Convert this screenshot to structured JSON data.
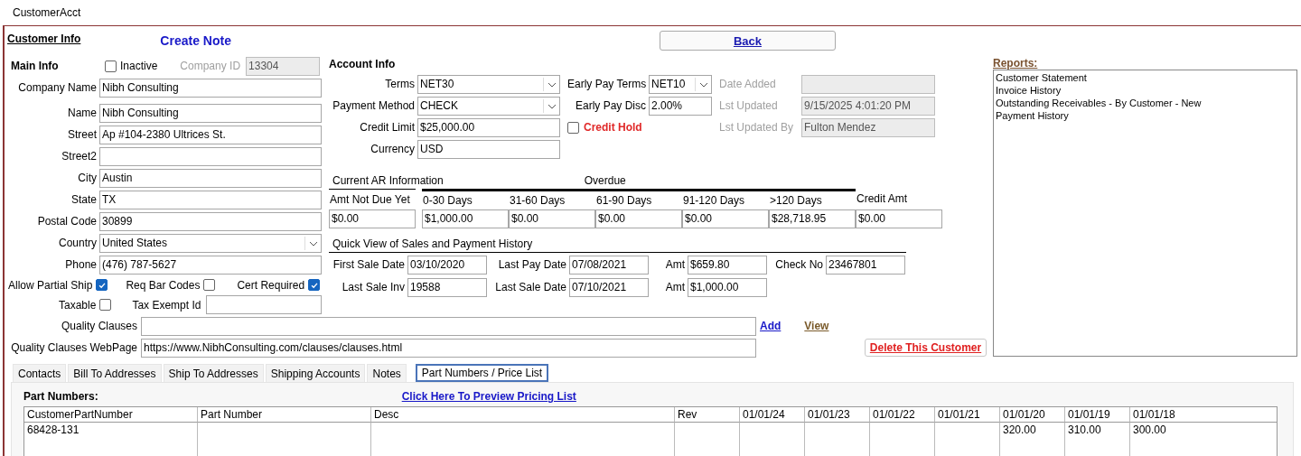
{
  "window": {
    "title": "CustomerAcct"
  },
  "header": {
    "section_link": "Customer Info",
    "create_note": "Create Note",
    "back_button": "Back"
  },
  "main_info": {
    "title": "Main Info",
    "inactive": {
      "label": "Inactive",
      "checked": false
    },
    "company_id": {
      "label": "Company ID",
      "value": "13304",
      "disabled": true
    },
    "fields": [
      {
        "label": "Company Name",
        "value": "Nibh Consulting",
        "kind": "text"
      },
      {
        "label": "Name",
        "value": "Nibh Consulting",
        "kind": "text"
      },
      {
        "label": "Street",
        "value": "Ap #104-2380 Ultrices St.",
        "kind": "text"
      },
      {
        "label": "Street2",
        "kind": "text"
      },
      {
        "label": "City",
        "value": "Austin",
        "kind": "text"
      },
      {
        "label": "State",
        "value": "TX",
        "kind": "text"
      },
      {
        "label": "Postal Code",
        "value": "30899",
        "kind": "text"
      },
      {
        "label": "Country",
        "value": "United States",
        "kind": "select"
      },
      {
        "label": "Phone",
        "value": "(476) 787-5627",
        "kind": "text"
      }
    ],
    "flags": [
      {
        "label": "Allow Partial Ship",
        "checked": true
      },
      {
        "label": "Req Bar Codes",
        "checked": false
      },
      {
        "label": "Cert Required",
        "checked": true
      }
    ],
    "taxable": {
      "label": "Taxable",
      "checked": false
    },
    "tax_exempt_id": {
      "label": "Tax Exempt Id"
    }
  },
  "account_info": {
    "title": "Account Info",
    "columns": [
      [
        {
          "label": "Terms",
          "value": "NET30",
          "kind": "select"
        },
        {
          "label": "Payment Method",
          "value": "CHECK",
          "kind": "select"
        },
        {
          "label": "Credit Limit",
          "value": "$25,000.00",
          "kind": "text"
        },
        {
          "label": "Currency",
          "value": "USD",
          "kind": "text"
        }
      ],
      [
        {
          "label": "Early Pay Terms",
          "value": "NET10",
          "kind": "select"
        },
        {
          "label": "Early Pay Disc",
          "value": "2.00%",
          "kind": "text"
        },
        {
          "label": "Credit Hold",
          "kind": "checkbox",
          "checked": false
        }
      ],
      [
        {
          "label": "Date Added",
          "kind": "text",
          "disabled": true
        },
        {
          "label": "Lst Updated",
          "value": "9/15/2025 4:01:20 PM",
          "kind": "text",
          "disabled": true
        },
        {
          "label": "Lst Updated By",
          "value": "Fulton Mendez",
          "kind": "text",
          "disabled": true
        }
      ]
    ]
  },
  "ar_info": {
    "title": "Current AR Information",
    "overdue_label": "Overdue",
    "buckets": [
      {
        "label": "Amt Not Due Yet",
        "value": "$0.00",
        "kind": "current"
      },
      {
        "label": "0-30 Days",
        "value": "$1,000.00",
        "kind": "overdue"
      },
      {
        "label": "31-60 Days",
        "value": "$0.00",
        "kind": "overdue"
      },
      {
        "label": "61-90 Days",
        "value": "$0.00",
        "kind": "overdue"
      },
      {
        "label": "91-120 Days",
        "value": "$0.00",
        "kind": "overdue"
      },
      {
        "label": ">120 Days",
        "value": "$28,718.95",
        "kind": "overdue"
      },
      {
        "label": "Credit Amt",
        "value": "$0.00",
        "kind": "credit"
      }
    ]
  },
  "quick_view": {
    "title": "Quick View of Sales and Payment History",
    "rows": [
      [
        {
          "label": "First Sale Date",
          "value": "03/10/2020"
        },
        {
          "label": "Last Pay Date",
          "value": "07/08/2021"
        },
        {
          "label": "Amt",
          "value": "$659.80"
        },
        {
          "label": "Check No",
          "value": "23467801"
        }
      ],
      [
        {
          "label": "Last Sale Inv",
          "value": "19588"
        },
        {
          "label": "Last Sale Date",
          "value": "07/10/2021"
        },
        {
          "label": "Amt",
          "value": "$1,000.00"
        }
      ]
    ]
  },
  "quality": {
    "clauses": {
      "label": "Quality Clauses"
    },
    "add_link": "Add",
    "view_link": "View",
    "webpage": {
      "label": "Quality Clauses WebPage",
      "value": "https://www.NibhConsulting.com/clauses/clauses.html"
    },
    "delete_button": "Delete This Customer"
  },
  "reports": {
    "title": "Reports:",
    "items": [
      {
        "label": "Customer Statement",
        "selected": false
      },
      {
        "label": "Invoice History",
        "selected": false
      },
      {
        "label": "Outstanding Receivables - By Customer - New",
        "selected": false
      },
      {
        "label": "Payment History",
        "selected": false
      }
    ]
  },
  "tabs": [
    {
      "label": "Contacts",
      "selected": false
    },
    {
      "label": "Bill To Addresses",
      "selected": false
    },
    {
      "label": "Ship To Addresses",
      "selected": false
    },
    {
      "label": "Shipping Accounts",
      "selected": false
    },
    {
      "label": "Notes",
      "selected": false
    },
    {
      "label": "Part Numbers / Price List",
      "selected": true
    }
  ],
  "part_numbers": {
    "title": "Part Numbers:",
    "preview_link": "Click Here To Preview Pricing List",
    "columns": [
      {
        "header": "CustomerPartNumber",
        "cells": [
          "68428-131"
        ]
      },
      {
        "header": "Part Number"
      },
      {
        "header": "Desc"
      },
      {
        "header": "Rev"
      },
      {
        "header": "01/01/24"
      },
      {
        "header": "01/01/23"
      },
      {
        "header": "01/01/22"
      },
      {
        "header": "01/01/21"
      },
      {
        "header": "01/01/20",
        "cells": [
          "320.00"
        ]
      },
      {
        "header": "01/01/19",
        "cells": [
          "310.00"
        ]
      },
      {
        "header": "01/01/18",
        "cells": [
          "300.00"
        ]
      }
    ]
  }
}
